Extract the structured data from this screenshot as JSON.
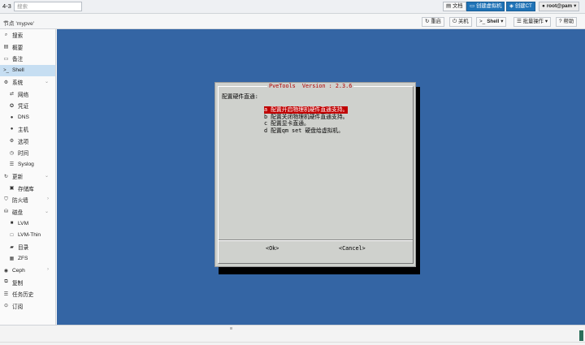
{
  "header": {
    "version": "4-3",
    "search_placeholder": "搜索",
    "docs": "文档",
    "create_vm": "创建虚拟机",
    "create_ct": "创建CT",
    "user": "root@pam"
  },
  "subbar": {
    "breadcrumb": "节点 'mypve'",
    "reboot": "重启",
    "shutdown": "关机",
    "shell": "Shell",
    "bulk": "批量操作",
    "help": "帮助"
  },
  "sidebar": {
    "items": [
      {
        "label": "搜索",
        "icon": "search-icon"
      },
      {
        "label": "概要",
        "icon": "book-icon"
      },
      {
        "label": "备注",
        "icon": "note-icon"
      },
      {
        "label": "Shell",
        "icon": "terminal-icon"
      },
      {
        "label": "系统",
        "icon": "gear-icon"
      },
      {
        "label": "网络",
        "icon": "network-icon"
      },
      {
        "label": "凭证",
        "icon": "certificate-icon"
      },
      {
        "label": "DNS",
        "icon": "globe-icon"
      },
      {
        "label": "主机",
        "icon": "globe-icon"
      },
      {
        "label": "选项",
        "icon": "gear-icon"
      },
      {
        "label": "时间",
        "icon": "clock-icon"
      },
      {
        "label": "Syslog",
        "icon": "list-icon"
      },
      {
        "label": "更新",
        "icon": "refresh-icon"
      },
      {
        "label": "存储库",
        "icon": "folder-icon"
      },
      {
        "label": "防火墙",
        "icon": "shield-icon"
      },
      {
        "label": "磁盘",
        "icon": "disk-icon"
      },
      {
        "label": "LVM",
        "icon": "square-icon"
      },
      {
        "label": "LVM-Thin",
        "icon": "square-outline-icon"
      },
      {
        "label": "目录",
        "icon": "folder-icon"
      },
      {
        "label": "ZFS",
        "icon": "table-icon"
      },
      {
        "label": "Ceph",
        "icon": "ceph-icon"
      },
      {
        "label": "复制",
        "icon": "copy-icon"
      },
      {
        "label": "任务历史",
        "icon": "list-icon"
      },
      {
        "label": "订阅",
        "icon": "support-icon"
      }
    ],
    "selected": "Shell"
  },
  "dialog": {
    "title": "PveTools  Version : 2.3.6",
    "prompt": "配置硬件直通:",
    "options": [
      "a 配置开启物理机硬件直通支持。",
      "b 配置关闭物理机硬件直通支持。",
      "c 配置显卡直通。",
      "d 配置qm set 硬盘给虚拟机。"
    ],
    "ok": "<Ok>",
    "cancel": "<Cancel>"
  }
}
